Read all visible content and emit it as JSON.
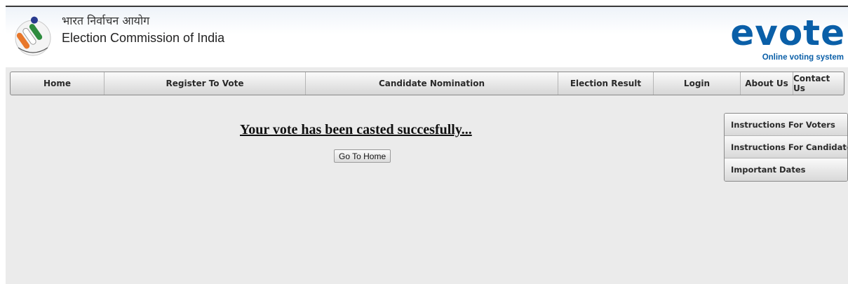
{
  "header": {
    "hindi_title": "भारत निर्वाचन आयोग",
    "english_title": "Election Commission of India",
    "logo_word": "evote",
    "logo_tagline": "Online voting system"
  },
  "nav": {
    "items": [
      {
        "label": "Home"
      },
      {
        "label": "Register To Vote"
      },
      {
        "label": "Candidate Nomination"
      },
      {
        "label": "Election Result"
      },
      {
        "label": "Login"
      },
      {
        "label": "About Us"
      },
      {
        "label": "Contact Us"
      }
    ]
  },
  "main": {
    "message": "Your vote has been casted succesfully...",
    "home_button": "Go To Home"
  },
  "sidebar": {
    "items": [
      {
        "label": "Instructions For Voters"
      },
      {
        "label": "Instructions For Candidates"
      },
      {
        "label": "Important Dates"
      }
    ]
  },
  "colors": {
    "brand_blue": "#0a5fa8",
    "content_bg": "#ebebeb",
    "emblem_orange": "#e8772a",
    "emblem_green": "#2e8b3e"
  },
  "icons": [
    "election-commission-emblem-icon",
    "evote-logo-icon"
  ]
}
